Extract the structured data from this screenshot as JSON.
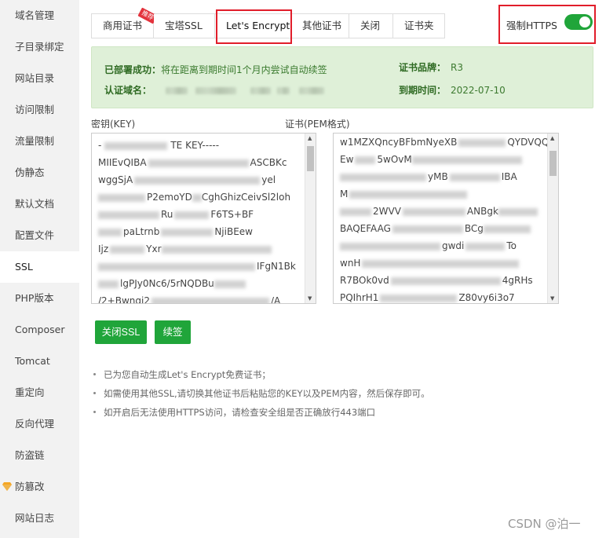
{
  "sidebar": {
    "items": [
      {
        "label": "域名管理"
      },
      {
        "label": "子目录绑定"
      },
      {
        "label": "网站目录"
      },
      {
        "label": "访问限制"
      },
      {
        "label": "流量限制"
      },
      {
        "label": "伪静态"
      },
      {
        "label": "默认文档"
      },
      {
        "label": "配置文件"
      },
      {
        "label": "SSL"
      },
      {
        "label": "PHP版本"
      },
      {
        "label": "Composer"
      },
      {
        "label": "Tomcat"
      },
      {
        "label": "重定向"
      },
      {
        "label": "反向代理"
      },
      {
        "label": "防盗链"
      },
      {
        "label": "防篡改"
      },
      {
        "label": "网站日志"
      }
    ],
    "active_index": 8
  },
  "tabs": [
    {
      "label": "商用证书",
      "badge": "推荐"
    },
    {
      "label": "宝塔SSL"
    },
    {
      "label": "Let's Encrypt"
    },
    {
      "label": "其他证书"
    },
    {
      "label": "关闭"
    },
    {
      "label": "证书夹"
    }
  ],
  "https": {
    "label": "强制HTTPS",
    "enabled": true
  },
  "status": {
    "deploy_label": "已部署成功：",
    "deploy_value": "将在距离到期时间1个月内尝试自动续签",
    "domain_label": "认证域名：",
    "brand_label": "证书品牌：",
    "brand_value": "R3",
    "expire_label": "到期时间：",
    "expire_value": "2022-07-10"
  },
  "key": {
    "label": "密钥(KEY)",
    "lines": [
      "-",
      "MIIEvQIBA",
      "wggSjA",
      "",
      "",
      "",
      "",
      "",
      "",
      ""
    ],
    "fragments": [
      "TE KEY-----",
      "ASCBKc",
      "yel",
      "P2emoYD",
      "CghGhizCeivSl2loh",
      "Ru",
      "F6TS+BF",
      "paLtrnb",
      "NjiBEew",
      "Ijz",
      "Yxr",
      "IFgN1Bk",
      "lgPJy0Nc6/5rNQDBu",
      "/2+Bwnqi2",
      "/A"
    ]
  },
  "cert": {
    "label": "证书(PEM格式)",
    "lines": [
      "w1MZXQncyBFbmNyeXB",
      "Ew",
      "",
      "M",
      "",
      "BAQEFAAG",
      "",
      "wnH",
      "R7BOk0vd",
      "PQIhrH1"
    ],
    "fragments": [
      "QYDVQQD",
      "5wOvM",
      "yMB",
      "IBA",
      "2WVV",
      "ANBgk",
      "BCg",
      "gwdi",
      "To",
      "4gRHs",
      "Z80vy6i3o7"
    ]
  },
  "buttons": {
    "close_ssl": "关闭SSL",
    "renew": "续签"
  },
  "tips": [
    "已为您自动生成Let's Encrypt免费证书；",
    "如需使用其他SSL,请切换其他证书后粘贴您的KEY以及PEM内容，然后保存即可。",
    "如开启后无法使用HTTPS访问，请检查安全组是否正确放行443端口"
  ],
  "watermark": "CSDN @泊一",
  "colors": {
    "accent": "#20a53a",
    "highlight": "#e11d2a",
    "status_bg": "#dff0d8"
  }
}
